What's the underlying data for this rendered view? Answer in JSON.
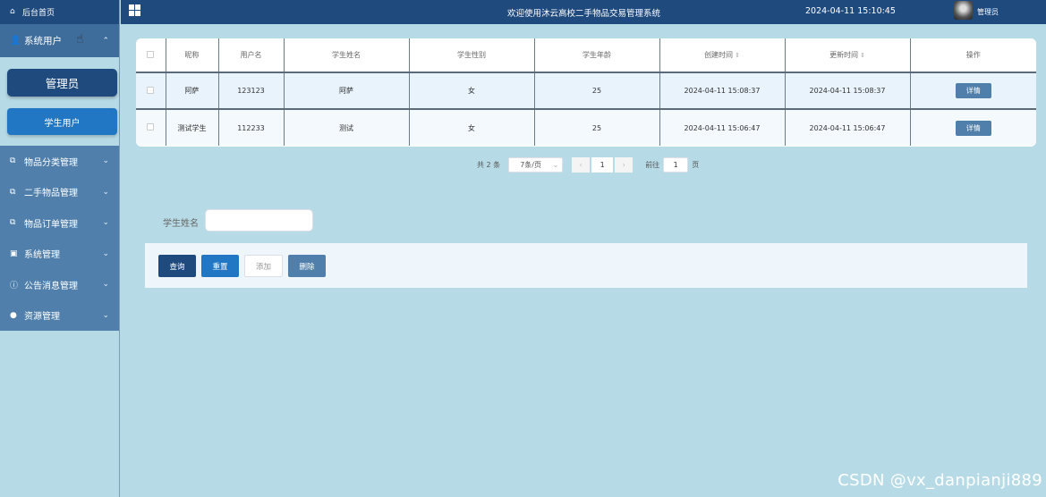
{
  "sidebar": {
    "home": "后台首页",
    "group": "系统用户",
    "submenu": {
      "admin": "管理员",
      "student": "学生用户"
    },
    "items": [
      {
        "label": "物品分类管理",
        "icon": "external-link-icon"
      },
      {
        "label": "二手物品管理",
        "icon": "external-link-icon"
      },
      {
        "label": "物品订单管理",
        "icon": "external-link-icon"
      },
      {
        "label": "系统管理",
        "icon": "image-icon"
      },
      {
        "label": "公告消息管理",
        "icon": "info-icon"
      },
      {
        "label": "资源管理",
        "icon": "location-icon"
      }
    ]
  },
  "header": {
    "title": "欢迎使用沐云高校二手物品交易管理系统",
    "time": "2024-04-11 15:10:45",
    "user": "管理员"
  },
  "table": {
    "columns": [
      "昵称",
      "用户名",
      "学生姓名",
      "学生性别",
      "学生年龄",
      "创建时间",
      "更新时间",
      "操作"
    ],
    "rows": [
      {
        "nickname": "阿萨",
        "username": "123123",
        "name": "阿萨",
        "gender": "女",
        "age": "25",
        "created": "2024-04-11 15:08:37",
        "updated": "2024-04-11 15:08:37",
        "action": "详情"
      },
      {
        "nickname": "测试学生",
        "username": "112233",
        "name": "测试",
        "gender": "女",
        "age": "25",
        "created": "2024-04-11 15:06:47",
        "updated": "2024-04-11 15:06:47",
        "action": "详情"
      }
    ]
  },
  "pagination": {
    "total": "共 2 条",
    "page_size": "7条/页",
    "current_page": "1",
    "goto_label": "前往",
    "goto_value": "1",
    "page_suffix": "页"
  },
  "search": {
    "label": "学生姓名",
    "value": ""
  },
  "buttons": {
    "query": "查询",
    "reset": "重置",
    "add": "添加",
    "delete": "删除"
  },
  "watermark": "CSDN @vx_danpianji889",
  "colors": {
    "primary": "#1e4a7e",
    "accent": "#2277c4",
    "menu": "#4f7faa",
    "background": "#b7dbe6"
  }
}
